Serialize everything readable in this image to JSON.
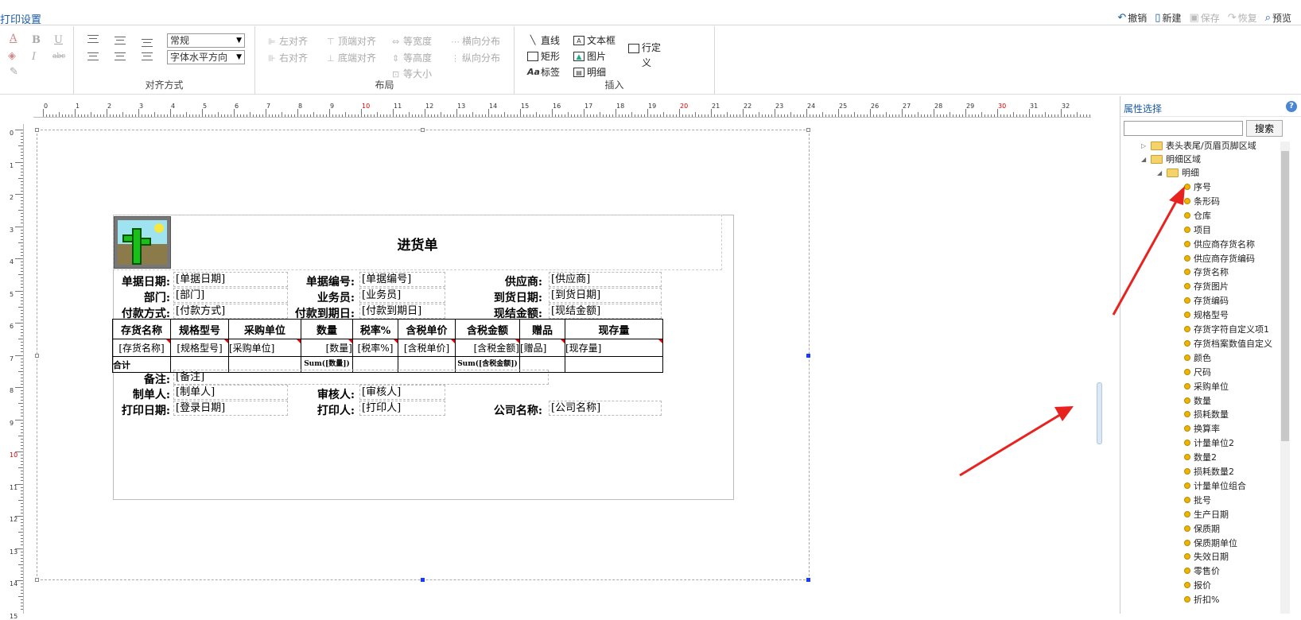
{
  "window": {
    "title": "打印设置"
  },
  "toolbar": {
    "undo": "撤销",
    "new": "新建",
    "save": "保存",
    "restore": "恢复",
    "preview": "预览"
  },
  "ribbon": {
    "font_style": "常规",
    "font_align": "字体水平方向",
    "align_group": "对齐方式",
    "layout_group": "布局",
    "insert_group": "插入",
    "layout": {
      "left_align": "左对齐",
      "top_align": "顶端对齐",
      "equal_width": "等宽度",
      "h_distribute": "横向分布",
      "right_align": "右对齐",
      "bottom_align": "底端对齐",
      "equal_height": "等高度",
      "v_distribute": "纵向分布",
      "equal_size": "等大小"
    },
    "insert": {
      "line": "直线",
      "textbox": "文本框",
      "row_def": "行定义",
      "rect": "矩形",
      "image": "图片",
      "label": "标签",
      "detail": "明细"
    }
  },
  "ruler": {
    "h": [
      "0",
      "1",
      "2",
      "3",
      "4",
      "5",
      "6",
      "7",
      "8",
      "9",
      "10",
      "11",
      "12",
      "13",
      "14",
      "15",
      "16",
      "17",
      "18",
      "19",
      "20",
      "21",
      "22",
      "23",
      "24",
      "25",
      "26",
      "27",
      "28",
      "29",
      "30",
      "31",
      "32"
    ],
    "v": [
      "0",
      "1",
      "2",
      "3",
      "4",
      "5",
      "6",
      "7",
      "8",
      "9",
      "10",
      "11",
      "12",
      "13",
      "14",
      "15"
    ]
  },
  "report": {
    "title": "进货单",
    "fields": [
      {
        "label": "单据日期:",
        "value": "[单据日期]"
      },
      {
        "label": "单据编号:",
        "value": "[单据编号]"
      },
      {
        "label": "供应商:",
        "value": "[供应商]"
      },
      {
        "label": "部门:",
        "value": "[部门]"
      },
      {
        "label": "业务员:",
        "value": "[业务员]"
      },
      {
        "label": "到货日期:",
        "value": "[到货日期]"
      },
      {
        "label": "付款方式:",
        "value": "[付款方式]"
      },
      {
        "label": "付款到期日:",
        "value": "[付款到期日]"
      },
      {
        "label": "现结金额:",
        "value": "[现结金额]"
      }
    ],
    "table": {
      "headers": [
        "存货名称",
        "规格型号",
        "采购单位",
        "数量",
        "税率%",
        "含税单价",
        "含税金额",
        "赠品",
        "现存量"
      ],
      "row": [
        "[存货名称]",
        "[规格型号]",
        "[采购单位]",
        "[数量]",
        "[税率%]",
        "[含税单价]",
        "[含税金额]",
        "[赠品]",
        "[现存量]"
      ],
      "footer": [
        "合计",
        "",
        "",
        "Sum([数量])",
        "",
        "",
        "Sum([含税金额])",
        "",
        ""
      ]
    },
    "footer_fields": [
      {
        "label": "备注:",
        "value": "[备注]"
      },
      {
        "label": "制单人:",
        "value": "[制单人]"
      },
      {
        "label": "审核人:",
        "value": "[审核人]"
      },
      {
        "label": "打印日期:",
        "value": "[登录日期]"
      },
      {
        "label": "打印人:",
        "value": "[打印人]"
      },
      {
        "label": "公司名称:",
        "value": "[公司名称]"
      }
    ]
  },
  "panel": {
    "title": "属性选择",
    "help": "?",
    "search_button": "搜索",
    "tree": {
      "n1": "表头表尾/页眉页脚区域",
      "n2": "明细区域",
      "n3": "明细",
      "items": [
        "序号",
        "条形码",
        "仓库",
        "项目",
        "供应商存货名称",
        "供应商存货编码",
        "存货名称",
        "存货图片",
        "存货编码",
        "规格型号",
        "存货字符自定义项1",
        "存货档案数值自定义",
        "颜色",
        "尺码",
        "采购单位",
        "数量",
        "损耗数量",
        "换算率",
        "计量单位2",
        "数量2",
        "损耗数量2",
        "计量单位组合",
        "批号",
        "生产日期",
        "保质期",
        "保质期单位",
        "失效日期",
        "零售价",
        "报价",
        "折扣%"
      ]
    }
  },
  "colors": {
    "accent": "#1a5aa5",
    "arrow": "#e8231f"
  }
}
